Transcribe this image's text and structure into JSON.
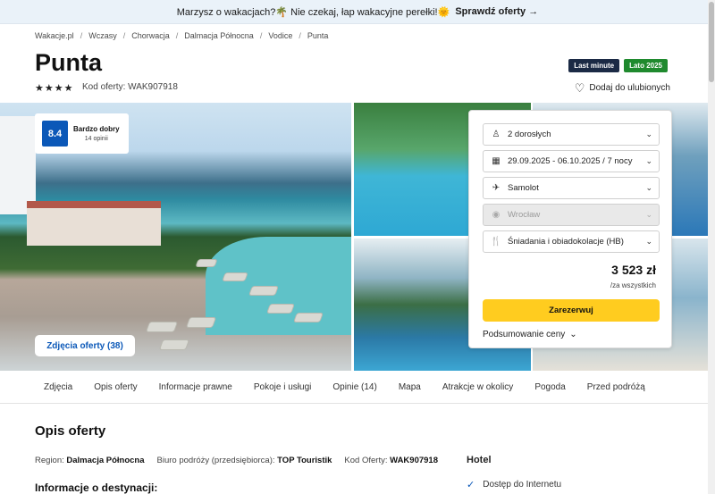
{
  "promo": {
    "text": "Marzysz o wakacjach?🌴 Nie czekaj, łap wakacyjne perełki!🌞",
    "cta": "Sprawdź oferty"
  },
  "breadcrumb": [
    "Wakacje.pl",
    "Wczasy",
    "Chorwacja",
    "Dalmacja Północna",
    "Vodice",
    "Punta"
  ],
  "hotel": {
    "name": "Punta",
    "stars": 4,
    "offer_code": "Kod oferty: WAK907918"
  },
  "badges": [
    "Last minute",
    "Lato 2025"
  ],
  "favorite_label": "Dodaj do ulubionych",
  "rating": {
    "score": "8.4",
    "label": "Bardzo dobry",
    "count": "14 opinii"
  },
  "photos_button": "Zdjęcia oferty (38)",
  "booking": {
    "guests": "2 dorosłych",
    "dates": "29.09.2025 - 06.10.2025 / 7 nocy",
    "transport": "Samolot",
    "departure": "Wrocław",
    "board": "Śniadania i obiadokolacje (HB)",
    "price": "3 523 zł",
    "price_note": "/za wszystkich",
    "reserve_label": "Zarezerwuj",
    "summary_label": "Podsumowanie ceny"
  },
  "tabs": [
    "Zdjęcia",
    "Opis oferty",
    "Informacje prawne",
    "Pokoje i usługi",
    "Opinie (14)",
    "Mapa",
    "Atrakcje w okolicy",
    "Pogoda",
    "Przed podróżą"
  ],
  "description": {
    "title": "Opis oferty",
    "region_label": "Region:",
    "region_value": "Dalmacja Północna",
    "operator_label": "Biuro podróży (przedsiębiorca):",
    "operator_value": "TOP Touristik",
    "code_label": "Kod Oferty:",
    "code_value": "WAK907918",
    "destination_title": "Informacje o destynacji:"
  },
  "hotel_section": {
    "title": "Hotel",
    "amenities": [
      "Dostęp do Internetu"
    ]
  },
  "colors": {
    "primary": "#0b58b8",
    "reserve": "#ffcc1f",
    "last_minute": "#1b2a45",
    "summer": "#1f8a2e"
  }
}
